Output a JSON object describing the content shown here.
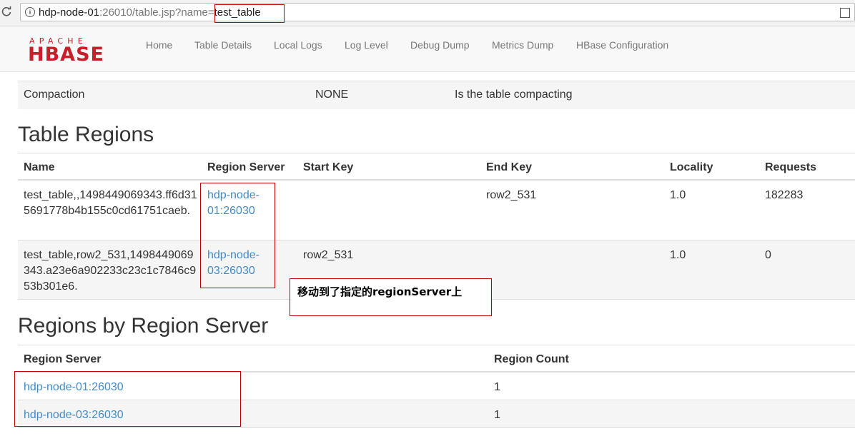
{
  "browser": {
    "url_host": "hdp-node-01",
    "url_rest": ":26010/table.jsp?name=",
    "url_table": "test_table"
  },
  "navbar": {
    "logo_top": "APACHE",
    "logo_bottom": "HBASE",
    "items": [
      "Home",
      "Table Details",
      "Local Logs",
      "Log Level",
      "Debug Dump",
      "Metrics Dump",
      "HBase Configuration"
    ]
  },
  "compaction": {
    "label": "Compaction",
    "value": "NONE",
    "description": "Is the table compacting"
  },
  "table_regions": {
    "title": "Table Regions",
    "headers": [
      "Name",
      "Region Server",
      "Start Key",
      "End Key",
      "Locality",
      "Requests"
    ],
    "rows": [
      {
        "name": "test_table,,1498449069343.ff6d315691778b4b155c0cd61751caeb.",
        "region_server": "hdp-node-01:26030",
        "start_key": "",
        "end_key": "row2_531",
        "locality": "1.0",
        "requests": "182283"
      },
      {
        "name": "test_table,row2_531,1498449069343.a23e6a902233c23c1c7846c953b301e6.",
        "region_server": "hdp-node-03:26030",
        "start_key": "row2_531",
        "end_key": "",
        "locality": "1.0",
        "requests": "0"
      }
    ]
  },
  "regions_by_server": {
    "title": "Regions by Region Server",
    "headers": [
      "Region Server",
      "Region Count"
    ],
    "rows": [
      {
        "server": "hdp-node-01:26030",
        "count": "1"
      },
      {
        "server": "hdp-node-03:26030",
        "count": "1"
      }
    ]
  },
  "annotation_note": "移动到了指定的regionServer上",
  "colors": {
    "link": "#428bca",
    "annotation_border": "#c00000",
    "logo_red": "#c8202a"
  }
}
